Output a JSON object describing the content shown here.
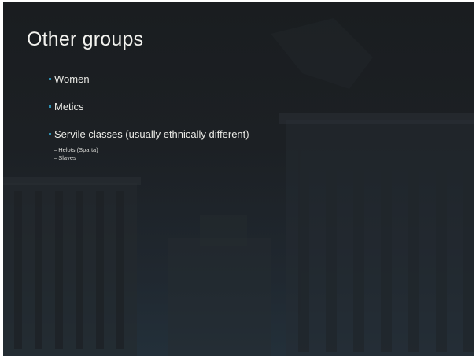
{
  "slide": {
    "title": "Other groups",
    "bullets": [
      {
        "dash": "",
        "label": "Women"
      },
      {
        "dash": "",
        "label": "Metics"
      },
      {
        "dash": "",
        "label": "Servile classes (usually ethnically different)"
      }
    ],
    "sub_bullets": [
      {
        "dash": "–",
        "label": "Helots (Sparta)"
      },
      {
        "dash": "–",
        "label": "Slaves"
      }
    ]
  },
  "colors": {
    "background": "#1c2024",
    "title": "#f2f2ee",
    "text": "#eaeae6",
    "bullet_accent": "#2e8fb0"
  }
}
